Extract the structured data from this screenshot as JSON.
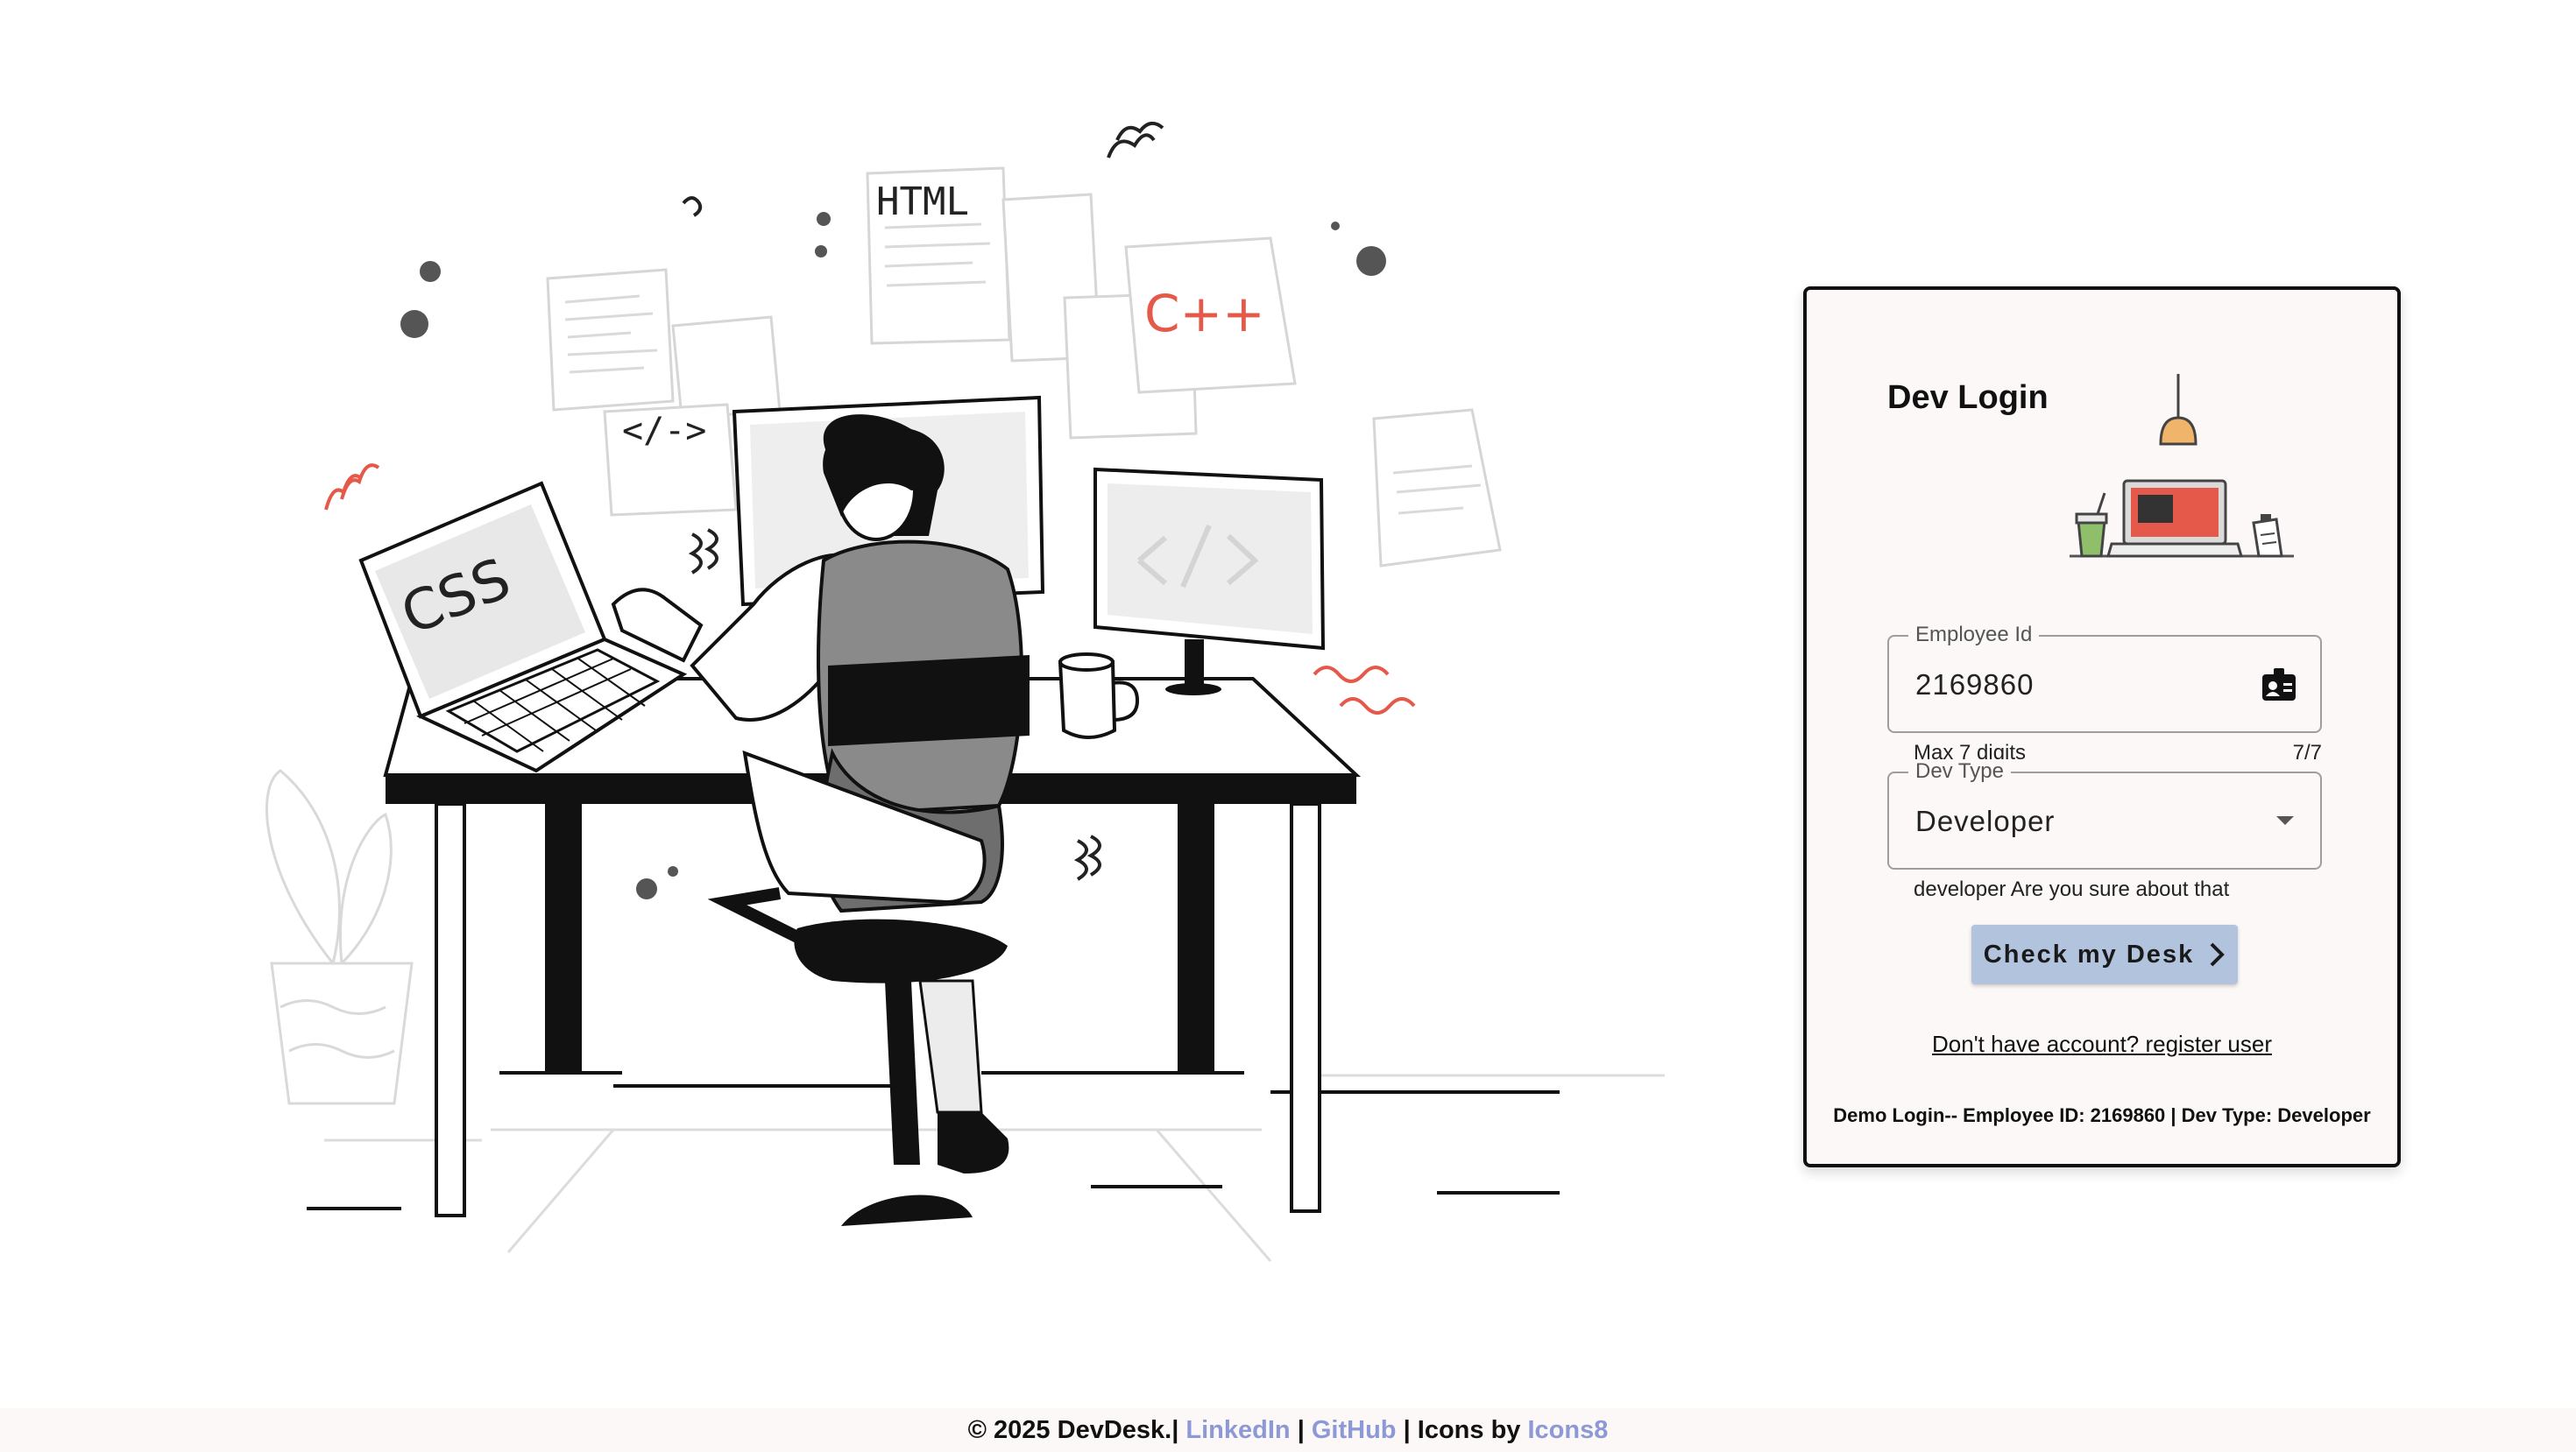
{
  "card": {
    "title": "Dev Login",
    "employee_field": {
      "legend": "Employee Id",
      "value": "2169860",
      "icon": "badge-icon"
    },
    "helper_max": "Max 7 digits",
    "helper_count": "7/7",
    "devtype_field": {
      "legend": "Dev Type",
      "value": "Developer",
      "icon": "dropdown-arrow-icon"
    },
    "helper_devtype": "developer Are you sure about that",
    "check_button": "Check my Desk",
    "register_link": "Don't have account? register user",
    "demo_text": "Demo Login-- Employee ID: 2169860 | Dev Type: Developer"
  },
  "illustration": {
    "code_labels": {
      "html": "HTML",
      "cpp": "C++",
      "css": "CSS",
      "tag": "</->"
    }
  },
  "footer": {
    "copyright": "© 2025 DevDesk.|",
    "linkedin": "LinkedIn",
    "sep1": "|",
    "github": "GitHub",
    "icons_by": "| Icons by",
    "icons8": "Icons8"
  },
  "colors": {
    "accent_red": "#e5594a",
    "button_bg": "#b2c3dd",
    "link": "#8d99d6",
    "card_bg": "#fcf8f7"
  }
}
